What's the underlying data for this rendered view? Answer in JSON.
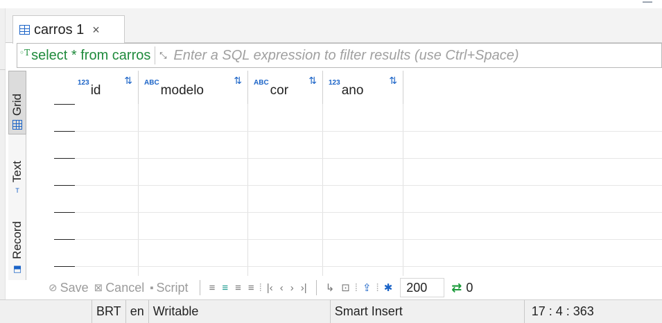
{
  "tab": {
    "label": "carros 1",
    "close": "×"
  },
  "filter": {
    "query": "select * from carros",
    "placeholder": "Enter a SQL expression to filter results (use Ctrl+Space)"
  },
  "panels": [
    {
      "label": "Grid",
      "icon": "grid-icon"
    },
    {
      "label": "Text",
      "icon": "text-icon"
    },
    {
      "label": "Record",
      "icon": "record-icon"
    }
  ],
  "columns": [
    {
      "type": "123",
      "name": "id"
    },
    {
      "type": "ABC",
      "name": "modelo"
    },
    {
      "type": "ABC",
      "name": "cor"
    },
    {
      "type": "123",
      "name": "ano"
    }
  ],
  "toolbar": {
    "save": "Save",
    "cancel": "Cancel",
    "script": "Script",
    "fetch_size": "200",
    "refresh_count": "0"
  },
  "status": {
    "timezone": "BRT",
    "locale": "en",
    "mode": "Writable",
    "insert_mode": "Smart Insert",
    "cursor": "17 : 4 : 363"
  },
  "colors": {
    "accent": "#1a63c7",
    "sql": "#1f8a3c",
    "refresh": "#1a9a3a"
  }
}
